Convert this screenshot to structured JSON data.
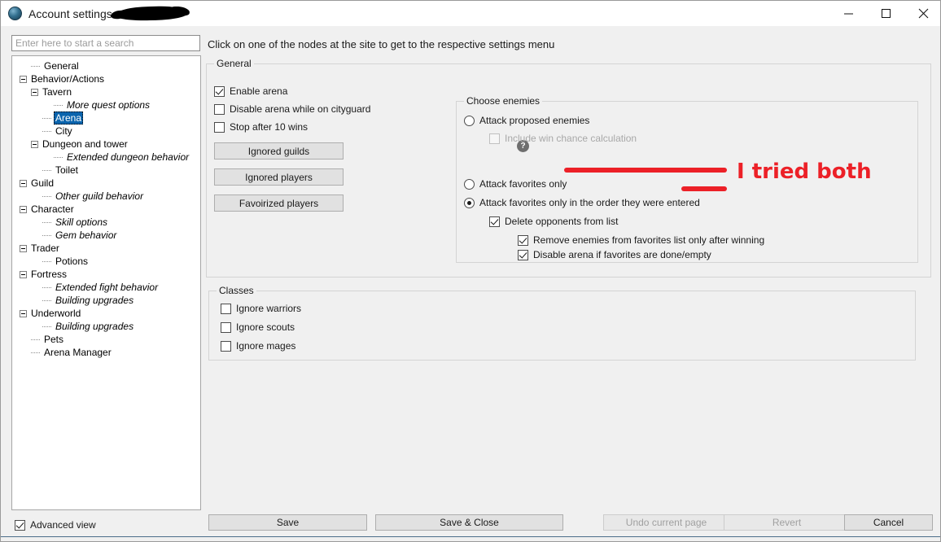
{
  "window": {
    "title": "Account settings",
    "icon": "globe-icon",
    "redacted": true,
    "controls": {
      "minimize": "minimize-icon",
      "maximize": "maximize-icon",
      "close": "close-icon"
    }
  },
  "search": {
    "placeholder": "Enter here to start a search",
    "value": ""
  },
  "hint": "Click on one of the nodes at the site to get to the respective settings menu",
  "tree": {
    "items": [
      {
        "label": "General",
        "depth": 1,
        "expander": false,
        "italic": false,
        "selected": false
      },
      {
        "label": "Behavior/Actions",
        "depth": 0,
        "expander": true,
        "italic": false,
        "selected": false
      },
      {
        "label": "Tavern",
        "depth": 1,
        "expander": true,
        "italic": false,
        "selected": false
      },
      {
        "label": "More quest options",
        "depth": 3,
        "expander": false,
        "italic": true,
        "selected": false
      },
      {
        "label": "Arena",
        "depth": 2,
        "expander": false,
        "italic": false,
        "selected": true
      },
      {
        "label": "City",
        "depth": 2,
        "expander": false,
        "italic": false,
        "selected": false
      },
      {
        "label": "Dungeon and tower",
        "depth": 1,
        "expander": true,
        "italic": false,
        "selected": false
      },
      {
        "label": "Extended dungeon behavior",
        "depth": 3,
        "expander": false,
        "italic": true,
        "selected": false
      },
      {
        "label": "Toilet",
        "depth": 2,
        "expander": false,
        "italic": false,
        "selected": false
      },
      {
        "label": "Guild",
        "depth": 0,
        "expander": true,
        "italic": false,
        "selected": false
      },
      {
        "label": "Other guild behavior",
        "depth": 2,
        "expander": false,
        "italic": true,
        "selected": false
      },
      {
        "label": "Character",
        "depth": 0,
        "expander": true,
        "italic": false,
        "selected": false
      },
      {
        "label": "Skill options",
        "depth": 2,
        "expander": false,
        "italic": true,
        "selected": false
      },
      {
        "label": "Gem behavior",
        "depth": 2,
        "expander": false,
        "italic": true,
        "selected": false
      },
      {
        "label": "Trader",
        "depth": 0,
        "expander": true,
        "italic": false,
        "selected": false
      },
      {
        "label": "Potions",
        "depth": 2,
        "expander": false,
        "italic": false,
        "selected": false
      },
      {
        "label": "Fortress",
        "depth": 0,
        "expander": true,
        "italic": false,
        "selected": false
      },
      {
        "label": "Extended fight behavior",
        "depth": 2,
        "expander": false,
        "italic": true,
        "selected": false
      },
      {
        "label": "Building upgrades",
        "depth": 2,
        "expander": false,
        "italic": true,
        "selected": false
      },
      {
        "label": "Underworld",
        "depth": 0,
        "expander": true,
        "italic": false,
        "selected": false
      },
      {
        "label": "Building upgrades",
        "depth": 2,
        "expander": false,
        "italic": true,
        "selected": false
      },
      {
        "label": "Pets",
        "depth": 1,
        "expander": false,
        "italic": false,
        "selected": false
      },
      {
        "label": "Arena Manager",
        "depth": 1,
        "expander": false,
        "italic": false,
        "selected": false
      }
    ]
  },
  "general_group": {
    "title": "General",
    "enable_arena": {
      "label": "Enable arena",
      "checked": true
    },
    "help_icon": "?",
    "disable_while_cityguard": {
      "label": "Disable arena while on cityguard",
      "checked": false
    },
    "stop_after_wins": {
      "label": "Stop after 10 wins",
      "checked": false
    },
    "buttons": {
      "ignored_guilds": "Ignored guilds",
      "ignored_players": "Ignored players",
      "favorized_players": "Favoirized players"
    }
  },
  "choose_enemies": {
    "title": "Choose enemies",
    "options": [
      {
        "label": "Attack proposed enemies",
        "selected": false
      },
      {
        "label": "Attack favorites only",
        "selected": false
      },
      {
        "label": "Attack favorites only in the order they were entered",
        "selected": true
      }
    ],
    "include_win_chance": {
      "label": "Include win chance calculation",
      "checked": false,
      "disabled": true
    },
    "delete_opponents": {
      "label": "Delete opponents from list",
      "checked": true
    },
    "remove_after_winning": {
      "label": "Remove enemies from favorites list only after winning",
      "checked": true
    },
    "disable_if_done": {
      "label": "Disable arena if favorites are done/empty",
      "checked": true
    }
  },
  "classes_group": {
    "title": "Classes",
    "items": [
      {
        "label": "Ignore warriors",
        "checked": false
      },
      {
        "label": "Ignore scouts",
        "checked": false
      },
      {
        "label": "Ignore mages",
        "checked": false
      }
    ]
  },
  "annotation": {
    "text": "I tried both",
    "color": "#ec2027"
  },
  "footer": {
    "advanced_view": {
      "label": "Advanced view",
      "checked": true
    },
    "save": "Save",
    "save_close": "Save & Close",
    "undo": "Undo current page",
    "revert": "Revert",
    "cancel": "Cancel"
  },
  "colors": {
    "selection": "#0a64ad",
    "annotation_red": "#ec2027",
    "window_bg": "#f0f0f0"
  }
}
